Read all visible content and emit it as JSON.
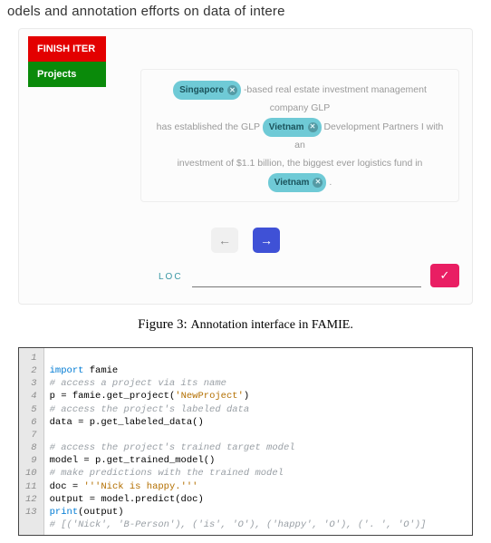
{
  "header_text": "odels and annotation efforts on data of intere",
  "sidebar": {
    "finish": "FINISH ITER",
    "projects": "Projects"
  },
  "annotation": {
    "t1": "-based real estate investment management company GLP",
    "t2a": "has established the GLP",
    "t2b": "Development Partners I with an",
    "t3a": "investment of $1.1 billion, the biggest ever logistics fund in",
    "tag1": "Singapore",
    "tag2": "Vietnam",
    "tag3": "Vietnam",
    "period": "."
  },
  "nav": {
    "prev": "←",
    "next": "→"
  },
  "bottom": {
    "loc": "LOC",
    "check": "✓"
  },
  "figcap": {
    "pre": "Figure 3: ",
    "body": "Annotation interface in FAMIE."
  },
  "code": {
    "l1_kw": "import",
    "l1_rest": " famie",
    "l2": "# access a project via its name",
    "l3_a": "p ",
    "l3_op": "=",
    "l3_b": " famie.get_project(",
    "l3_str": "'NewProject'",
    "l3_c": ")",
    "l4": "# access the project's labeled data",
    "l5_a": "data ",
    "l5_op": "=",
    "l5_b": " p.get_labeled_data()",
    "l6": "",
    "l7": "# access the project's trained target model",
    "l8_a": "model ",
    "l8_op": "=",
    "l8_b": " p.get_trained_model()",
    "l9": "# make predictions with the trained model",
    "l10_a": "doc ",
    "l10_op": "=",
    "l10_b": " ",
    "l10_str": "'''Nick is happy.'''",
    "l11_a": "output ",
    "l11_op": "=",
    "l11_b": " model.predict(doc)",
    "l12_fn": "print",
    "l12_rest": "(output)",
    "l13": "# [('Nick', 'B-Person'), ('is', 'O'), ('happy', 'O'), ('. ', 'O')]"
  }
}
